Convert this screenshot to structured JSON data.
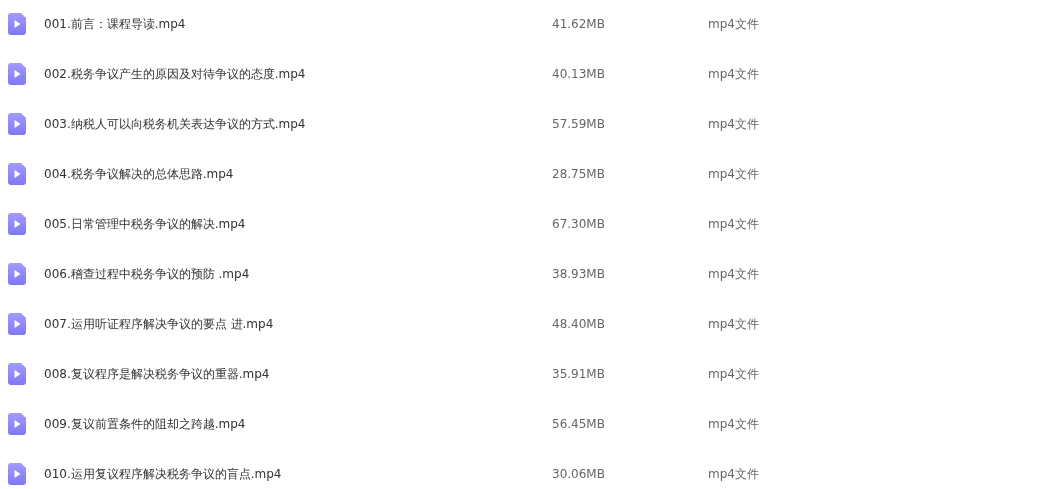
{
  "files": [
    {
      "name": "001.前言：课程导读.mp4",
      "size": "41.62MB",
      "type": "mp4文件"
    },
    {
      "name": "002.税务争议产生的原因及对待争议的态度.mp4",
      "size": "40.13MB",
      "type": "mp4文件"
    },
    {
      "name": "003.纳税人可以向税务机关表达争议的方式.mp4",
      "size": "57.59MB",
      "type": "mp4文件"
    },
    {
      "name": "004.税务争议解决的总体思路.mp4",
      "size": "28.75MB",
      "type": "mp4文件"
    },
    {
      "name": "005.日常管理中税务争议的解决.mp4",
      "size": "67.30MB",
      "type": "mp4文件"
    },
    {
      "name": "006.稽查过程中税务争议的预防 .mp4",
      "size": "38.93MB",
      "type": "mp4文件"
    },
    {
      "name": "007.运用听证程序解决争议的要点 进.mp4",
      "size": "48.40MB",
      "type": "mp4文件"
    },
    {
      "name": "008.复议程序是解决税务争议的重器.mp4",
      "size": "35.91MB",
      "type": "mp4文件"
    },
    {
      "name": "009.复议前置条件的阻却之跨越.mp4",
      "size": "56.45MB",
      "type": "mp4文件"
    },
    {
      "name": "010.运用复议程序解决税务争议的盲点.mp4",
      "size": "30.06MB",
      "type": "mp4文件"
    }
  ]
}
